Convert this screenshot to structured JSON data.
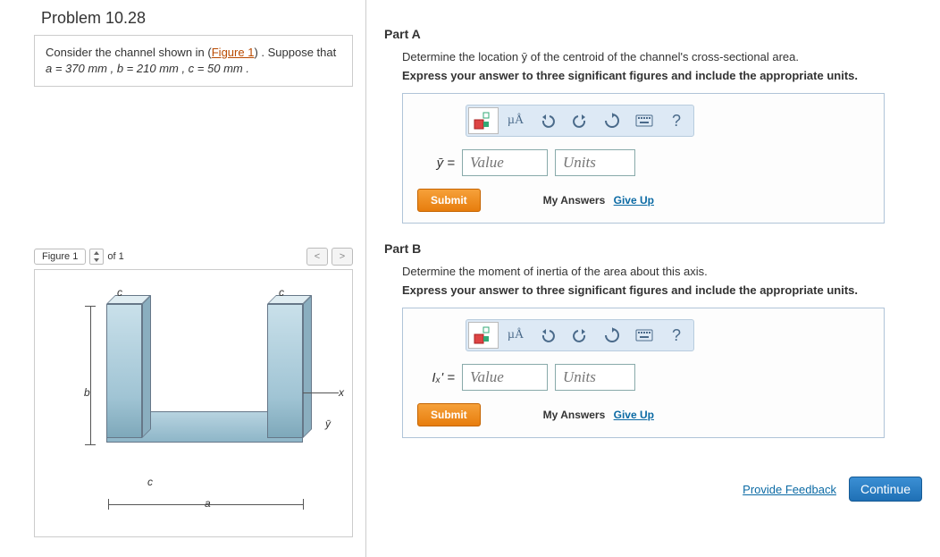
{
  "problem": {
    "title": "Problem 10.28",
    "prompt_pre": "Consider the channel shown in (",
    "figure_link": "Figure 1",
    "prompt_post": ") . Suppose that ",
    "givens_html": "a = 370  mm , b = 210  mm , c = 50  mm ."
  },
  "figure": {
    "selector_label": "Figure 1",
    "count_text": "of 1",
    "prev": "<",
    "next": ">",
    "labels": {
      "a": "a",
      "b": "b",
      "c": "c",
      "x": "x",
      "y": "ȳ"
    }
  },
  "partA": {
    "title": "Part A",
    "desc": "Determine the location ȳ of the centroid of the channel's cross-sectional area.",
    "instr": "Express your answer to three significant figures and include the appropriate units.",
    "var_label": "ȳ =",
    "value_ph": "Value",
    "units_ph": "Units",
    "submit": "Submit",
    "myanswers": "My Answers",
    "giveup": "Give Up"
  },
  "partB": {
    "title": "Part B",
    "desc": "Determine the moment of inertia of the area about this axis.",
    "instr": "Express your answer to three significant figures and include the appropriate units.",
    "var_label": "Iₓ' =",
    "value_ph": "Value",
    "units_ph": "Units",
    "submit": "Submit",
    "myanswers": "My Answers",
    "giveup": "Give Up"
  },
  "toolbar": {
    "units_tool": "µÅ",
    "question": "?"
  },
  "footer": {
    "feedback": "Provide Feedback",
    "continue": "Continue"
  }
}
